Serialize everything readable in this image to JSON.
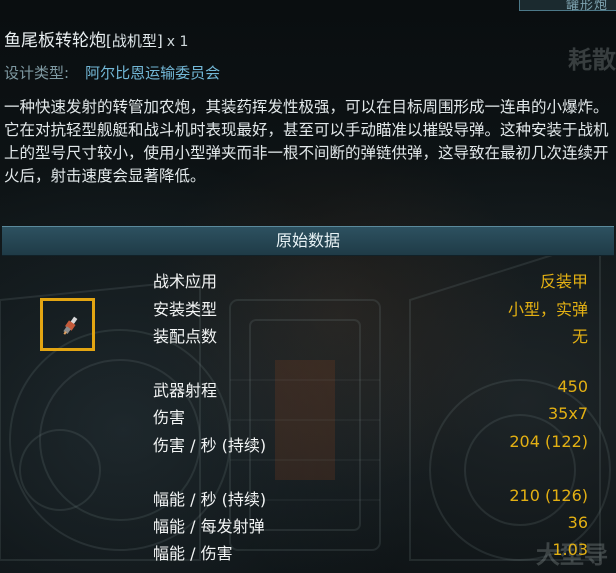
{
  "corner_label": "罐形炮",
  "watermark_right": "耗散",
  "watermark_bottom": "大型导",
  "weapon": {
    "name": "鱼尾板转轮炮",
    "variant": "[战机型]",
    "quantity": "x 1"
  },
  "design": {
    "label": "设计类型:",
    "value": "阿尔比恩运输委员会"
  },
  "description": "一种快速发射的转管加农炮，其装药挥发性极强，可以在目标周围形成一连串的小爆炸。它在对抗轻型舰艇和战斗机时表现最好，甚至可以手动瞄准以摧毁导弹。这种安装于战机上的型号尺寸较小，使用小型弹夹而非一根不间断的弹链供弹，这导致在最初几次连续开火后，射击速度会显著降低。",
  "section_title": "原始数据",
  "icon": "weapon-thumbnail-icon",
  "colors": {
    "value_text": "#e3b013",
    "design_value": "#72b7d6",
    "icon_frame": "#e3a512",
    "header_bg": "#254653"
  },
  "stats": [
    {
      "label": "战术应用",
      "value": "反装甲"
    },
    {
      "label": "安装类型",
      "value": "小型，实弹"
    },
    {
      "label": "装配点数",
      "value": "无"
    },
    {
      "label": "武器射程",
      "value": "450"
    },
    {
      "label": "伤害",
      "value": "35x7"
    },
    {
      "label": "伤害 / 秒 (持续)",
      "value": "204 (122)"
    },
    {
      "label": "幅能 / 秒 (持续)",
      "value": "210 (126)"
    },
    {
      "label": "幅能 / 每发射弹",
      "value": "36"
    },
    {
      "label": "幅能 / 伤害",
      "value": "1.03"
    }
  ]
}
